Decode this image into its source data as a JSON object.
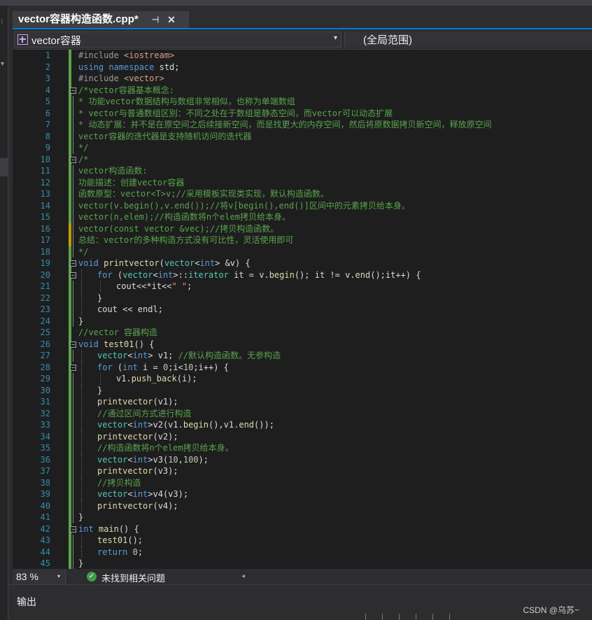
{
  "tab": {
    "title": "vector容器构造函数.cpp*",
    "pin": "⊣",
    "close": "✕"
  },
  "nav": {
    "scope": "vector容器",
    "scope_arrow": "▾",
    "member": "(全局范围)"
  },
  "status": {
    "zoom": "83 %",
    "zoom_arrow": "▾",
    "issues": "未找到相关问题",
    "issues_icon": "✓",
    "scroll_left": "◂"
  },
  "output": {
    "label": "输出"
  },
  "watermark": "CSDN @乌苏~",
  "colors": {
    "keyword": "#569cd6",
    "comment": "#57a64a",
    "string": "#d69d85",
    "number": "#b5cea8",
    "type": "#4ec9b0",
    "function": "#dcdcaa",
    "macro": "#9b9b9b",
    "line_number": "#2b91af",
    "text": "#dcdcdc",
    "background": "#1e1e1e",
    "saved_change": "#57a64a",
    "unsaved_change": "#c0a000"
  },
  "code": [
    {
      "n": "1",
      "indent": 0,
      "gutter": "saved",
      "fold": "",
      "tokens": [
        [
          "#include ",
          "macro"
        ],
        [
          "<iostream>",
          "string"
        ]
      ]
    },
    {
      "n": "2",
      "indent": 0,
      "gutter": "saved",
      "fold": "",
      "tokens": [
        [
          "using ",
          "keyword"
        ],
        [
          "namespace ",
          "keyword"
        ],
        [
          "std;",
          "text"
        ]
      ]
    },
    {
      "n": "3",
      "indent": 0,
      "gutter": "saved",
      "fold": "",
      "tokens": [
        [
          "#include ",
          "macro"
        ],
        [
          "<vector>",
          "string"
        ]
      ]
    },
    {
      "n": "4",
      "indent": 0,
      "gutter": "saved",
      "fold": "start",
      "tokens": [
        [
          "/*vector容器基本概念:",
          "comment"
        ]
      ]
    },
    {
      "n": "5",
      "indent": 0,
      "gutter": "saved",
      "fold": "in",
      "tokens": [
        [
          "* 功能vector数据结构与数组非常相似，也称为单端数组",
          "comment"
        ]
      ]
    },
    {
      "n": "6",
      "indent": 0,
      "gutter": "saved",
      "fold": "in",
      "tokens": [
        [
          "* vector与普通数组区别：不同之处在于数组是静态空间，而vector可以动态扩展",
          "comment"
        ]
      ]
    },
    {
      "n": "7",
      "indent": 0,
      "gutter": "saved",
      "fold": "in",
      "tokens": [
        [
          "* 动态扩展：并不是在原空间之后续接新空间，而是找更大的内存空间，然后将原数据拷贝新空间，释放原空间",
          "comment"
        ]
      ]
    },
    {
      "n": "8",
      "indent": 0,
      "gutter": "saved",
      "fold": "in",
      "tokens": [
        [
          "vector容器的迭代器是支持随机访问的迭代器",
          "comment"
        ]
      ]
    },
    {
      "n": "9",
      "indent": 0,
      "gutter": "saved",
      "fold": "in",
      "tokens": [
        [
          "*/",
          "comment"
        ]
      ]
    },
    {
      "n": "10",
      "indent": 0,
      "gutter": "saved",
      "fold": "start",
      "tokens": [
        [
          "/*",
          "comment"
        ]
      ]
    },
    {
      "n": "11",
      "indent": 0,
      "gutter": "saved",
      "fold": "in",
      "tokens": [
        [
          "vector构造函数:",
          "comment"
        ]
      ]
    },
    {
      "n": "12",
      "indent": 0,
      "gutter": "saved",
      "fold": "in",
      "tokens": [
        [
          "功能描述：创建vector容器",
          "comment"
        ]
      ]
    },
    {
      "n": "13",
      "indent": 0,
      "gutter": "saved",
      "fold": "in",
      "tokens": [
        [
          "函数原型：vector<T>v;//采用模板实现类实现，默认构造函数。",
          "comment"
        ]
      ]
    },
    {
      "n": "14",
      "indent": 0,
      "gutter": "saved",
      "fold": "in",
      "tokens": [
        [
          "vector(v.begin(),v.end());//将v[begin(),end()]区间中的元素拷贝给本身。",
          "comment"
        ]
      ]
    },
    {
      "n": "15",
      "indent": 0,
      "gutter": "saved",
      "fold": "in",
      "tokens": [
        [
          "vector(n,elem);//构造函数将n个elem拷贝给本身。",
          "comment"
        ]
      ]
    },
    {
      "n": "16",
      "indent": 0,
      "gutter": "unsaved",
      "fold": "in",
      "tokens": [
        [
          "vector(const vector &vec);//拷贝构造函数。",
          "comment"
        ]
      ]
    },
    {
      "n": "17",
      "indent": 0,
      "gutter": "unsaved",
      "fold": "in",
      "tokens": [
        [
          "总结：vector的多种构造方式没有可比性，灵活使用即可",
          "comment"
        ]
      ]
    },
    {
      "n": "18",
      "indent": 0,
      "gutter": "saved",
      "fold": "in",
      "tokens": [
        [
          "*/",
          "comment"
        ]
      ]
    },
    {
      "n": "19",
      "indent": 0,
      "gutter": "saved",
      "fold": "start",
      "tokens": [
        [
          "void ",
          "keyword"
        ],
        [
          "printvector",
          "function"
        ],
        [
          "(",
          "text"
        ],
        [
          "vector",
          "type"
        ],
        [
          "<",
          "text"
        ],
        [
          "int",
          "keyword"
        ],
        [
          "> &v) {",
          "text"
        ]
      ]
    },
    {
      "n": "20",
      "indent": 1,
      "gutter": "saved",
      "fold": "start",
      "tokens": [
        [
          "for ",
          "keyword"
        ],
        [
          "(",
          "text"
        ],
        [
          "vector",
          "type"
        ],
        [
          "<",
          "text"
        ],
        [
          "int",
          "keyword"
        ],
        [
          ">::",
          "text"
        ],
        [
          "iterator",
          "type"
        ],
        [
          " it = v.",
          "text"
        ],
        [
          "begin",
          "function"
        ],
        [
          "(); it != v.",
          "text"
        ],
        [
          "end",
          "function"
        ],
        [
          "();it++) {",
          "text"
        ]
      ]
    },
    {
      "n": "21",
      "indent": 2,
      "gutter": "saved",
      "fold": "in",
      "tokens": [
        [
          "cout<<*it<<",
          "text"
        ],
        [
          "\" \"",
          "string"
        ],
        [
          ";",
          "text"
        ]
      ]
    },
    {
      "n": "22",
      "indent": 1,
      "gutter": "saved",
      "fold": "in",
      "tokens": [
        [
          "}",
          "text"
        ]
      ]
    },
    {
      "n": "23",
      "indent": 1,
      "gutter": "saved",
      "fold": "in",
      "tokens": [
        [
          "cout << endl;",
          "text"
        ]
      ]
    },
    {
      "n": "24",
      "indent": 0,
      "gutter": "saved",
      "fold": "in",
      "tokens": [
        [
          "}",
          "text"
        ]
      ]
    },
    {
      "n": "25",
      "indent": 0,
      "gutter": "saved",
      "fold": "",
      "tokens": [
        [
          "//vector 容器构造",
          "comment"
        ]
      ]
    },
    {
      "n": "26",
      "indent": 0,
      "gutter": "saved",
      "fold": "start",
      "tokens": [
        [
          "void ",
          "keyword"
        ],
        [
          "test01",
          "function"
        ],
        [
          "() {",
          "text"
        ]
      ]
    },
    {
      "n": "27",
      "indent": 1,
      "gutter": "saved",
      "fold": "in",
      "tokens": [
        [
          "vector",
          "type"
        ],
        [
          "<",
          "text"
        ],
        [
          "int",
          "keyword"
        ],
        [
          "> v1; ",
          "text"
        ],
        [
          "//默认构造函数。无参构造",
          "comment"
        ]
      ]
    },
    {
      "n": "28",
      "indent": 1,
      "gutter": "saved",
      "fold": "start",
      "tokens": [
        [
          "for ",
          "keyword"
        ],
        [
          "(",
          "text"
        ],
        [
          "int",
          "keyword"
        ],
        [
          " i = ",
          "text"
        ],
        [
          "0",
          "number"
        ],
        [
          ";i<",
          "text"
        ],
        [
          "10",
          "number"
        ],
        [
          ";i++) {",
          "text"
        ]
      ]
    },
    {
      "n": "29",
      "indent": 2,
      "gutter": "saved",
      "fold": "in",
      "tokens": [
        [
          "v1.",
          "text"
        ],
        [
          "push_back",
          "function"
        ],
        [
          "(i);",
          "text"
        ]
      ]
    },
    {
      "n": "30",
      "indent": 1,
      "gutter": "saved",
      "fold": "in",
      "tokens": [
        [
          "}",
          "text"
        ]
      ]
    },
    {
      "n": "31",
      "indent": 1,
      "gutter": "saved",
      "fold": "in",
      "tokens": [
        [
          "printvector",
          "function"
        ],
        [
          "(v1);",
          "text"
        ]
      ]
    },
    {
      "n": "32",
      "indent": 1,
      "gutter": "saved",
      "fold": "in",
      "tokens": [
        [
          "//通过区间方式进行构造",
          "comment"
        ]
      ]
    },
    {
      "n": "33",
      "indent": 1,
      "gutter": "saved",
      "fold": "in",
      "tokens": [
        [
          "vector",
          "type"
        ],
        [
          "<",
          "text"
        ],
        [
          "int",
          "keyword"
        ],
        [
          ">v2(v1.",
          "text"
        ],
        [
          "begin",
          "function"
        ],
        [
          "(),v1.",
          "text"
        ],
        [
          "end",
          "function"
        ],
        [
          "());",
          "text"
        ]
      ]
    },
    {
      "n": "34",
      "indent": 1,
      "gutter": "saved",
      "fold": "in",
      "tokens": [
        [
          "printvector",
          "function"
        ],
        [
          "(v2);",
          "text"
        ]
      ]
    },
    {
      "n": "35",
      "indent": 1,
      "gutter": "saved",
      "fold": "in",
      "tokens": [
        [
          "//构造函数将n个elem拷贝给本身。",
          "comment"
        ]
      ]
    },
    {
      "n": "36",
      "indent": 1,
      "gutter": "saved",
      "fold": "in",
      "tokens": [
        [
          "vector",
          "type"
        ],
        [
          "<",
          "text"
        ],
        [
          "int",
          "keyword"
        ],
        [
          ">v3(",
          "text"
        ],
        [
          "10",
          "number"
        ],
        [
          ",",
          "text"
        ],
        [
          "100",
          "number"
        ],
        [
          ");",
          "text"
        ]
      ]
    },
    {
      "n": "37",
      "indent": 1,
      "gutter": "saved",
      "fold": "in",
      "tokens": [
        [
          "printvector",
          "function"
        ],
        [
          "(v3);",
          "text"
        ]
      ]
    },
    {
      "n": "38",
      "indent": 1,
      "gutter": "saved",
      "fold": "in",
      "tokens": [
        [
          "//拷贝构造",
          "comment"
        ]
      ]
    },
    {
      "n": "39",
      "indent": 1,
      "gutter": "saved",
      "fold": "in",
      "tokens": [
        [
          "vector",
          "type"
        ],
        [
          "<",
          "text"
        ],
        [
          "int",
          "keyword"
        ],
        [
          ">v4(v3);",
          "text"
        ]
      ]
    },
    {
      "n": "40",
      "indent": 1,
      "gutter": "saved",
      "fold": "in",
      "tokens": [
        [
          "printvector",
          "function"
        ],
        [
          "(v4);",
          "text"
        ]
      ]
    },
    {
      "n": "41",
      "indent": 0,
      "gutter": "saved",
      "fold": "in",
      "tokens": [
        [
          "}",
          "text"
        ]
      ]
    },
    {
      "n": "42",
      "indent": 0,
      "gutter": "saved",
      "fold": "start",
      "tokens": [
        [
          "int ",
          "keyword"
        ],
        [
          "main",
          "function"
        ],
        [
          "() {",
          "text"
        ]
      ]
    },
    {
      "n": "43",
      "indent": 1,
      "gutter": "saved",
      "fold": "in",
      "tokens": [
        [
          "test01",
          "function"
        ],
        [
          "();",
          "text"
        ]
      ]
    },
    {
      "n": "44",
      "indent": 1,
      "gutter": "saved",
      "fold": "in",
      "tokens": [
        [
          "return ",
          "keyword"
        ],
        [
          "0",
          "number"
        ],
        [
          ";",
          "text"
        ]
      ]
    },
    {
      "n": "45",
      "indent": 0,
      "gutter": "saved",
      "fold": "in",
      "tokens": [
        [
          "}",
          "text"
        ]
      ]
    }
  ]
}
